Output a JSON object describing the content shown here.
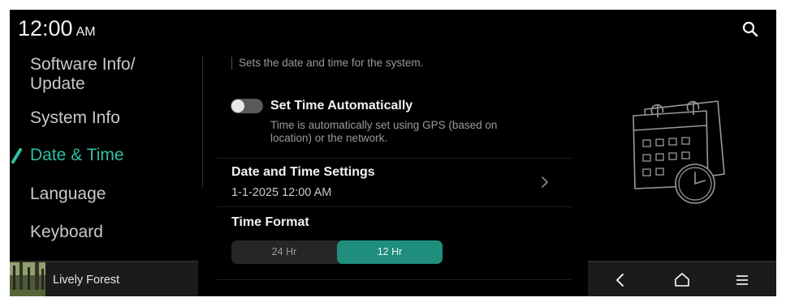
{
  "status": {
    "time": "12:00",
    "ampm": "AM"
  },
  "icons": {
    "search": "search-icon",
    "back": "back-icon",
    "home": "home-icon",
    "menu": "menu-icon",
    "chevron": "chevron-right-icon"
  },
  "sidebar": {
    "items": [
      {
        "label": "Software Info/",
        "label2": "Update",
        "active": false
      },
      {
        "label": "System Info",
        "active": false
      },
      {
        "label": "Date & Time",
        "active": true
      },
      {
        "label": "Language",
        "active": false
      },
      {
        "label": "Keyboard",
        "active": false
      }
    ]
  },
  "main": {
    "description": "Sets the date and time for the system.",
    "auto_time": {
      "title": "Set Time Automatically",
      "subtitle": "Time is automatically set using GPS (based on location) or the network.",
      "enabled": false
    },
    "date_time_settings": {
      "title": "Date and Time Settings",
      "value": "1-1-2025 12:00 AM"
    },
    "time_format": {
      "title": "Time Format",
      "options": [
        "24 Hr",
        "12 Hr"
      ],
      "selected": "12 Hr"
    }
  },
  "media": {
    "title": "Lively Forest"
  },
  "colors": {
    "accent": "#2fbfa4",
    "segment_selected": "#1f8e7d",
    "background": "#000000"
  }
}
